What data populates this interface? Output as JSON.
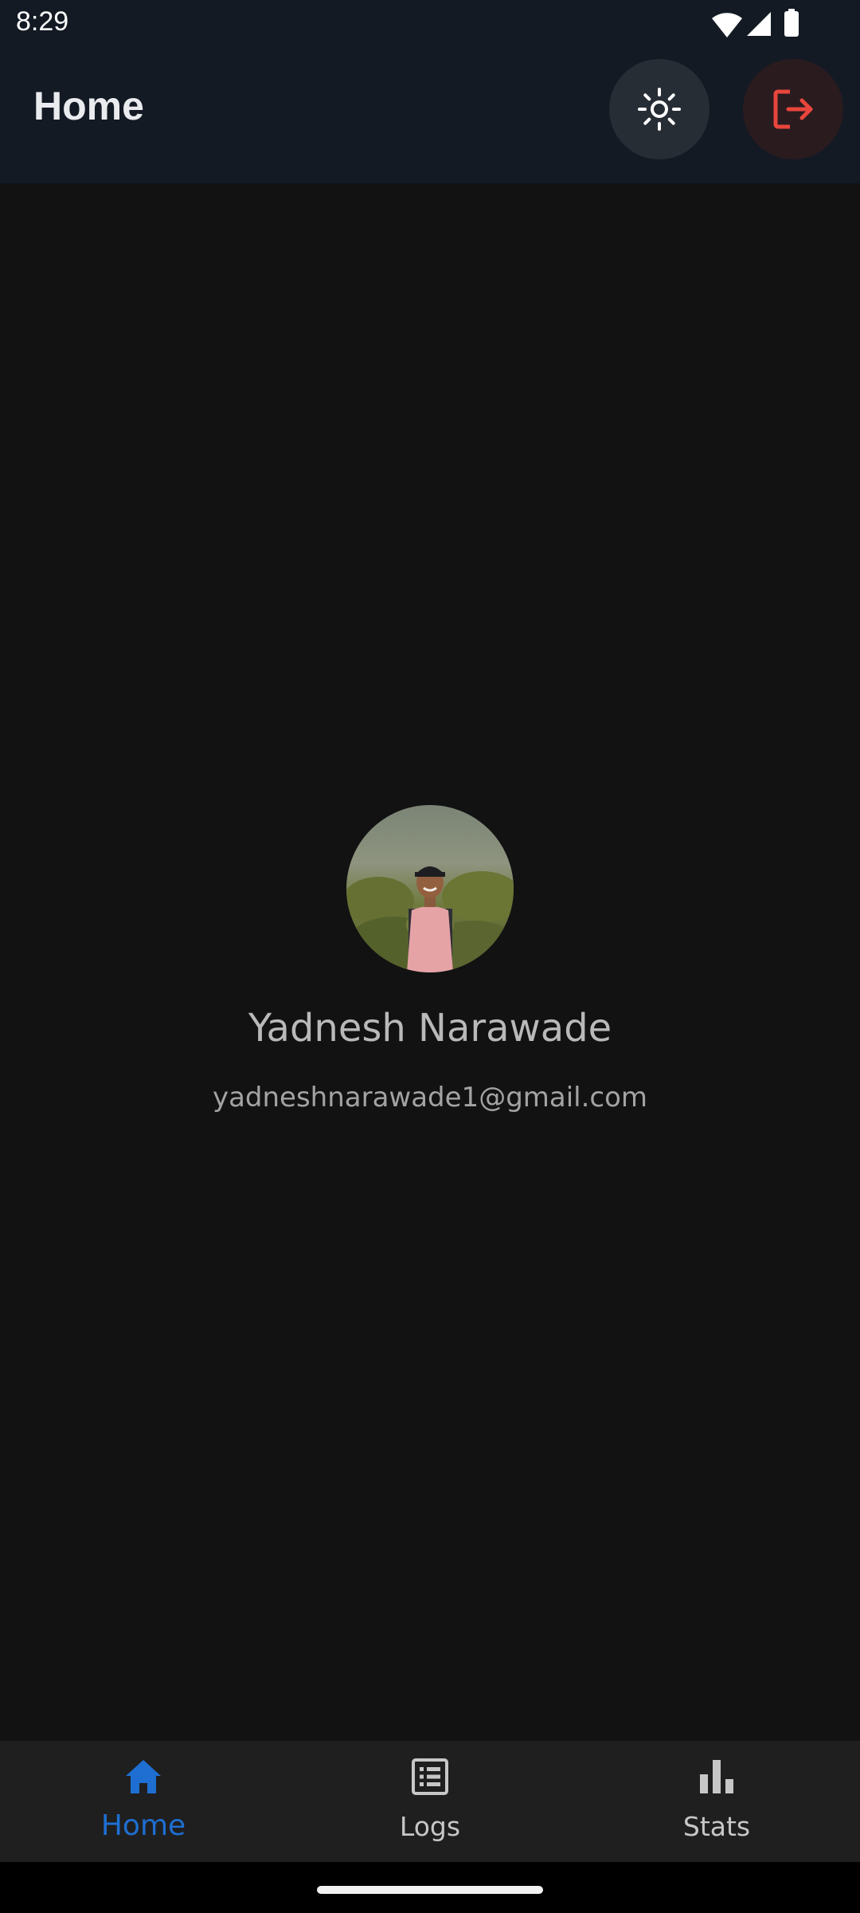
{
  "status_bar": {
    "time": "8:29",
    "icons": [
      "wifi-icon",
      "signal-icon",
      "battery-icon"
    ]
  },
  "app_bar": {
    "title": "Home",
    "actions": [
      {
        "name": "theme-toggle",
        "icon": "sun-icon"
      },
      {
        "name": "logout",
        "icon": "logout-icon"
      }
    ]
  },
  "profile": {
    "name": "Yadnesh Narawade",
    "email": "yadneshnarawade1@gmail.com"
  },
  "bottom_nav": {
    "items": [
      {
        "label": "Home",
        "icon": "home-icon",
        "active": true
      },
      {
        "label": "Logs",
        "icon": "list-icon",
        "active": false
      },
      {
        "label": "Stats",
        "icon": "bar-chart-icon",
        "active": false
      }
    ]
  },
  "colors": {
    "app_bar_bg": "#131a24",
    "background": "#121212",
    "accent": "#1e6fd1",
    "logout_red": "#e8463c",
    "nav_bg": "#1f1f20"
  }
}
